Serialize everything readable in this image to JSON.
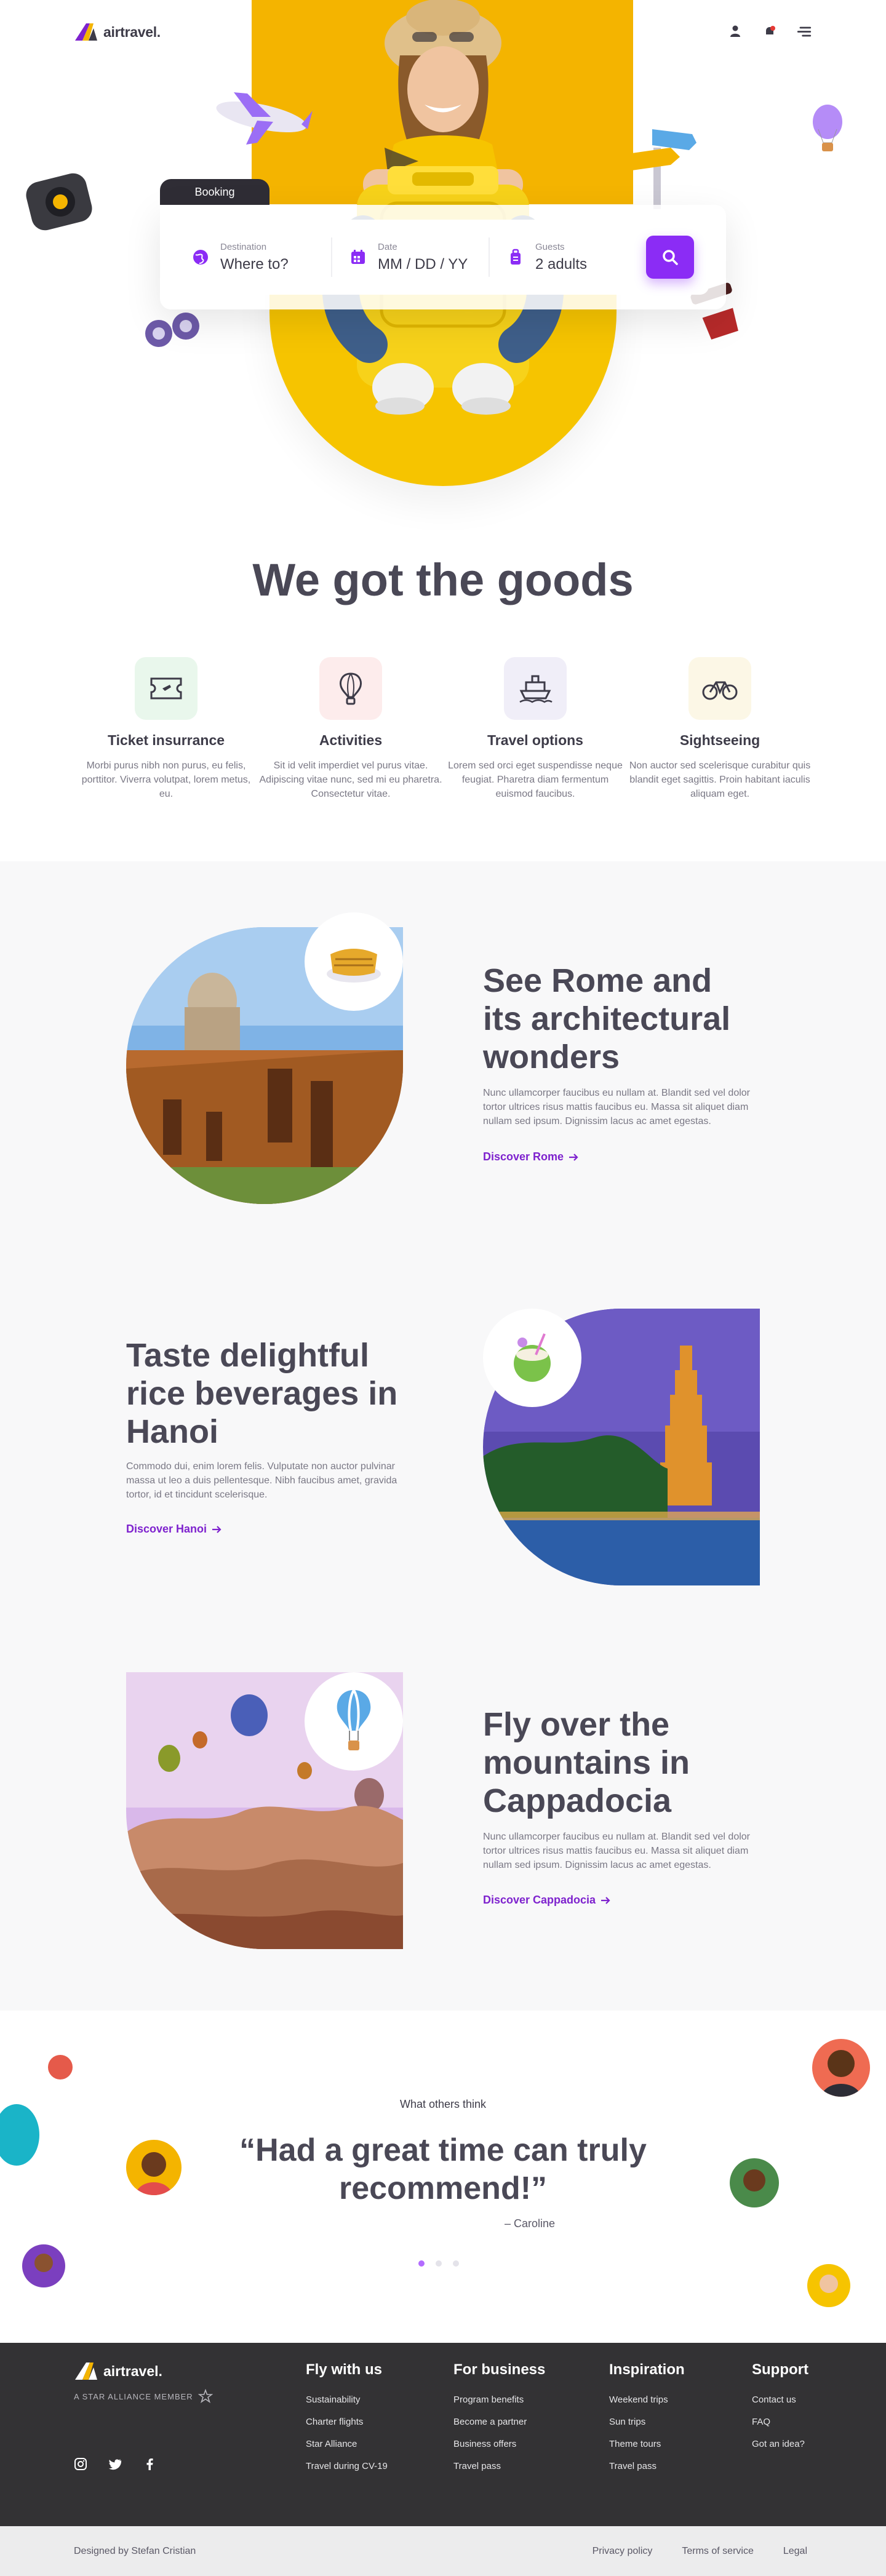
{
  "brand": {
    "name": "airtravel.",
    "footer_name": "airtravel.",
    "alliance": "A STAR ALLIANCE MEMBER",
    "accent": "#8b2cf5",
    "dark": "#333234"
  },
  "header": {
    "icons": [
      "user-icon",
      "notification-icon",
      "menu-icon"
    ]
  },
  "booking": {
    "tab": "Booking",
    "destination": {
      "label": "Destination",
      "value": "Where to?"
    },
    "date": {
      "label": "Date",
      "value": "MM / DD / YY"
    },
    "guests": {
      "label": "Guests",
      "value": "2 adults"
    }
  },
  "features": {
    "title": "We got the goods",
    "items": [
      {
        "title": "Ticket insurrance",
        "text": "Morbi purus nibh non purus, eu felis, porttitor. Viverra volutpat, lorem metus, eu.",
        "bg": "#e9f7ec"
      },
      {
        "title": "Activities",
        "text": "Sit id velit imperdiet vel purus vitae. Adipiscing vitae nunc, sed mi eu pharetra. Consectetur vitae.",
        "bg": "#fdecec"
      },
      {
        "title": "Travel options",
        "text": "Lorem sed orci eget suspendisse neque feugiat. Pharetra diam fermentum euismod faucibus.",
        "bg": "#f0eef8"
      },
      {
        "title": "Sightseeing",
        "text": "Non auctor sed scelerisque curabitur quis blandit eget sagittis. Proin habitant iaculis aliquam eget.",
        "bg": "#fcf7e6"
      }
    ]
  },
  "destinations": [
    {
      "title": "See Rome and its architectural wonders",
      "text": "Nunc ullamcorper faucibus eu nullam at. Blandit sed vel dolor tortor ultrices risus mattis faucibus eu. Massa sit aliquet diam nullam sed ipsum. Dignissim lacus ac amet egestas.",
      "link": "Discover Rome"
    },
    {
      "title": "Taste delightful rice beverages in Hanoi",
      "text": "Commodo dui, enim lorem felis. Vulputate non auctor pulvinar massa ut leo a duis pellentesque. Nibh faucibus amet, gravida tortor, id et tincidunt scelerisque.",
      "link": "Discover Hanoi"
    },
    {
      "title": "Fly over the mountains in Cappadocia",
      "text": "Nunc ullamcorper faucibus eu nullam at. Blandit sed vel dolor tortor ultrices risus mattis faucibus eu. Massa sit aliquet diam nullam sed ipsum. Dignissim lacus ac amet egestas.",
      "link": "Discover Cappadocia"
    }
  ],
  "testimonial": {
    "kicker": "What others think",
    "quote": "“Had a great time can truly recommend!”",
    "author": "– Caroline",
    "slides": 3,
    "active_slide": 1
  },
  "footer": {
    "columns": [
      {
        "title": "Fly with us",
        "items": [
          "Sustainability",
          "Charter flights",
          "Star Alliance",
          "Travel during CV-19"
        ]
      },
      {
        "title": "For business",
        "items": [
          "Program benefits",
          "Become a partner",
          "Business offers",
          "Travel pass"
        ]
      },
      {
        "title": "Inspiration",
        "items": [
          "Weekend trips",
          "Sun trips",
          "Theme tours",
          "Travel pass"
        ]
      },
      {
        "title": "Support",
        "items": [
          "Contact us",
          "FAQ",
          "Got an idea?"
        ]
      }
    ],
    "social": [
      "instagram-icon",
      "twitter-icon",
      "facebook-icon"
    ],
    "credit": "Designed by Stefan Cristian",
    "legal": [
      "Privacy policy",
      "Terms of service",
      "Legal"
    ]
  }
}
